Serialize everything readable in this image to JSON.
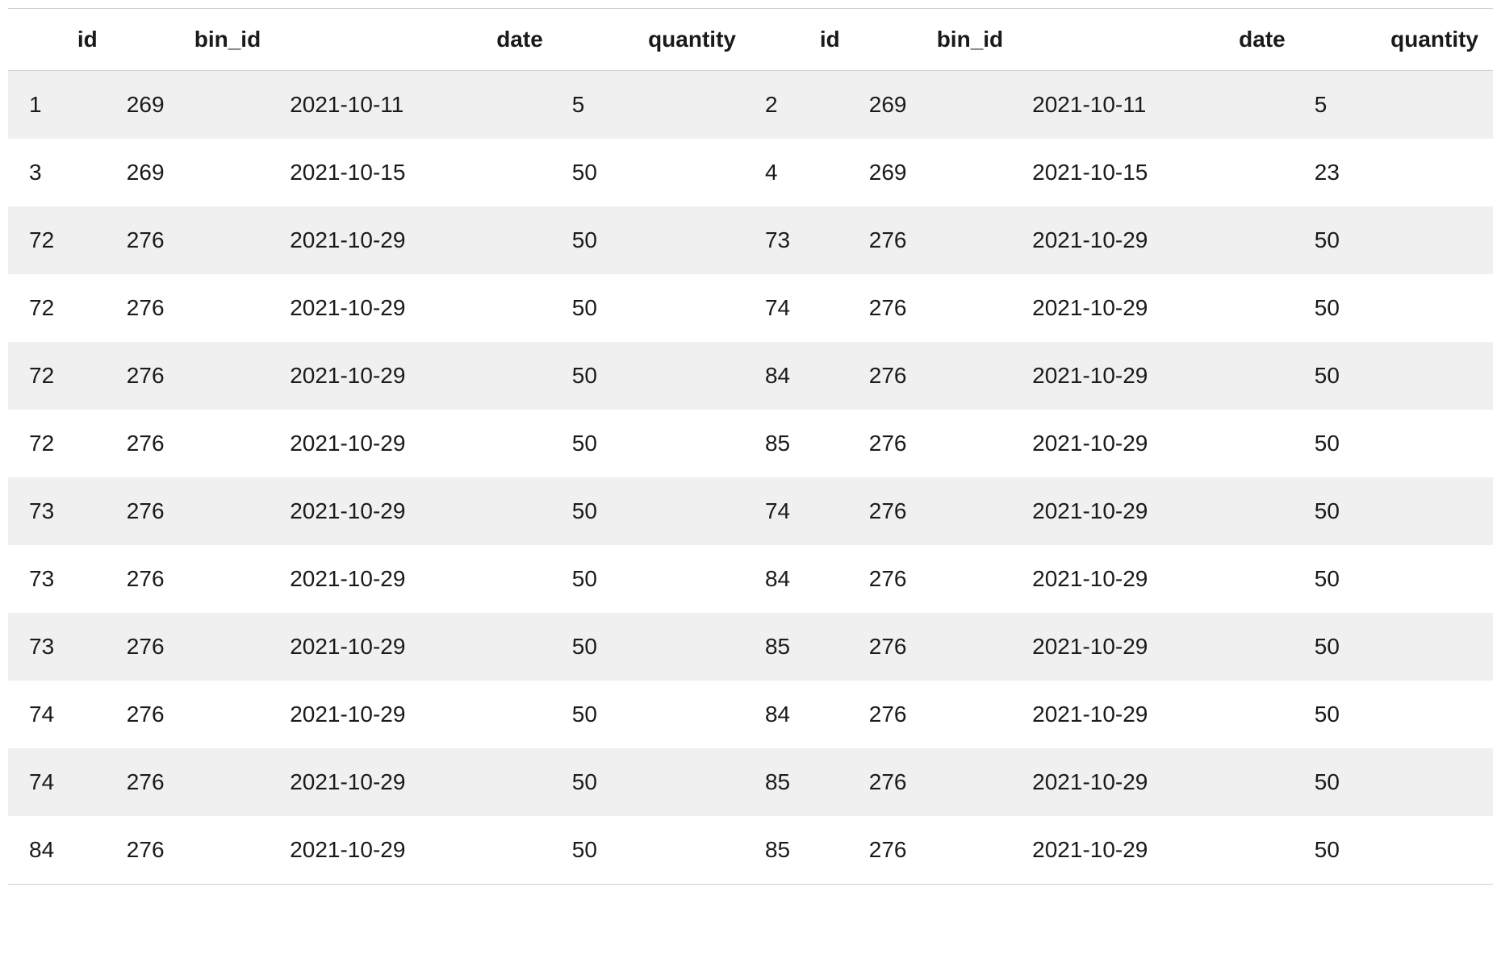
{
  "table": {
    "headers": [
      "id",
      "bin_id",
      "date",
      "quantity",
      "id",
      "bin_id",
      "date",
      "quantity"
    ],
    "rows": [
      [
        "1",
        "269",
        "2021-10-11",
        "5",
        "2",
        "269",
        "2021-10-11",
        "5"
      ],
      [
        "3",
        "269",
        "2021-10-15",
        "50",
        "4",
        "269",
        "2021-10-15",
        "23"
      ],
      [
        "72",
        "276",
        "2021-10-29",
        "50",
        "73",
        "276",
        "2021-10-29",
        "50"
      ],
      [
        "72",
        "276",
        "2021-10-29",
        "50",
        "74",
        "276",
        "2021-10-29",
        "50"
      ],
      [
        "72",
        "276",
        "2021-10-29",
        "50",
        "84",
        "276",
        "2021-10-29",
        "50"
      ],
      [
        "72",
        "276",
        "2021-10-29",
        "50",
        "85",
        "276",
        "2021-10-29",
        "50"
      ],
      [
        "73",
        "276",
        "2021-10-29",
        "50",
        "74",
        "276",
        "2021-10-29",
        "50"
      ],
      [
        "73",
        "276",
        "2021-10-29",
        "50",
        "84",
        "276",
        "2021-10-29",
        "50"
      ],
      [
        "73",
        "276",
        "2021-10-29",
        "50",
        "85",
        "276",
        "2021-10-29",
        "50"
      ],
      [
        "74",
        "276",
        "2021-10-29",
        "50",
        "84",
        "276",
        "2021-10-29",
        "50"
      ],
      [
        "74",
        "276",
        "2021-10-29",
        "50",
        "85",
        "276",
        "2021-10-29",
        "50"
      ],
      [
        "84",
        "276",
        "2021-10-29",
        "50",
        "85",
        "276",
        "2021-10-29",
        "50"
      ]
    ]
  }
}
